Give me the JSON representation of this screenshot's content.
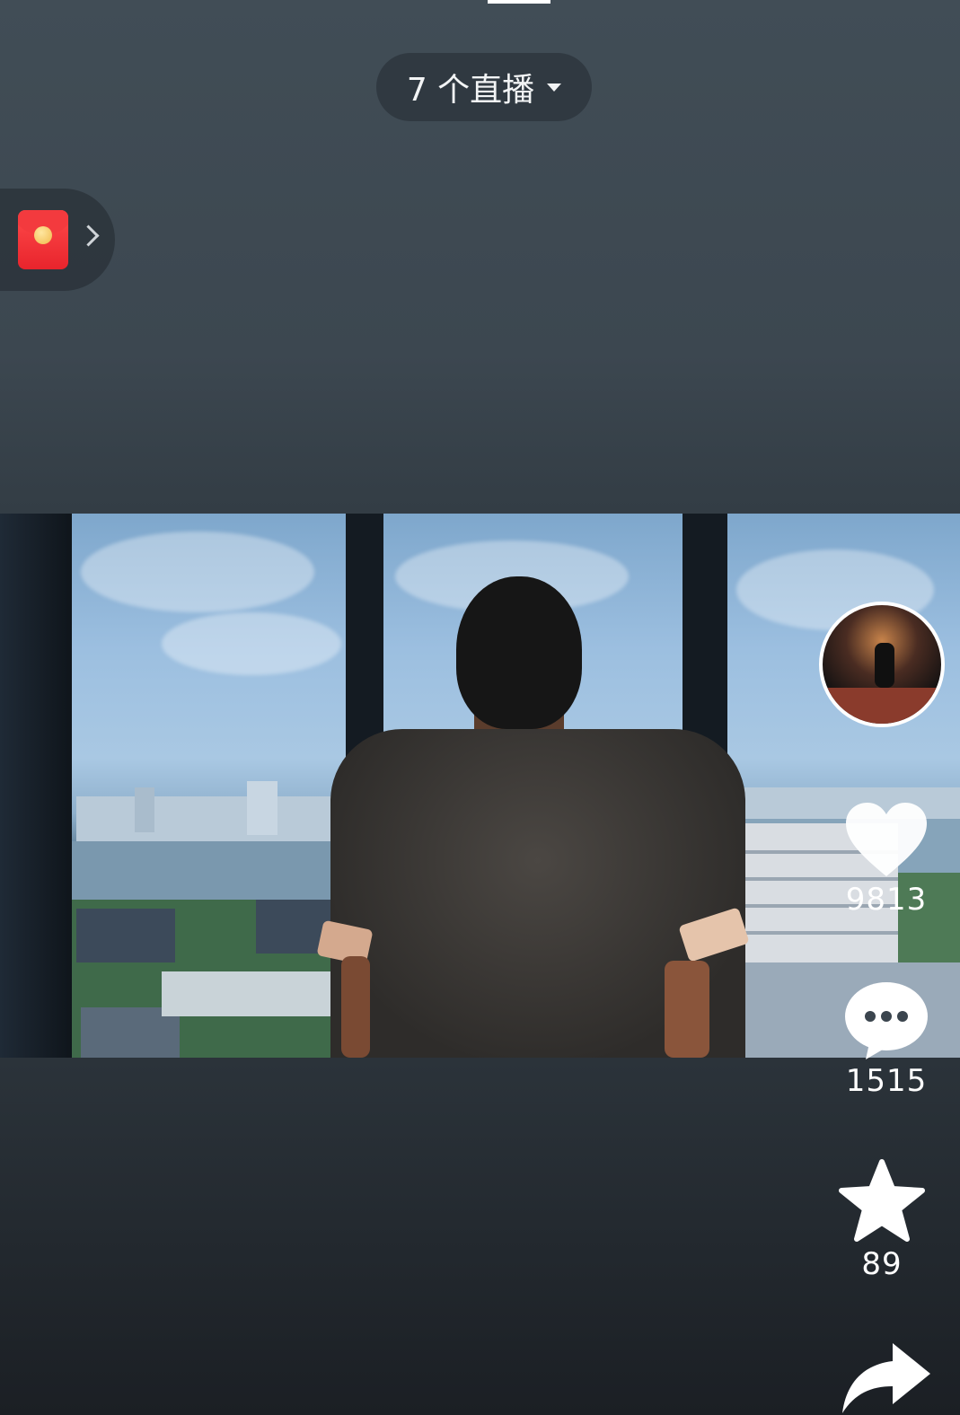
{
  "header": {
    "live_label": "7 个直播"
  },
  "actions": {
    "like_count": "9813",
    "comment_count": "1515",
    "favorite_count": "89"
  },
  "icons": {
    "live_dropdown": "caret-down-icon",
    "red_packet": "red-packet-icon",
    "chevron": "chevron-right-icon",
    "like": "heart-icon",
    "comment": "comment-bubble-icon",
    "favorite": "star-icon",
    "share": "share-arrow-icon"
  },
  "colors": {
    "background_top": "#414d56",
    "background_bottom": "#1b1f24",
    "red_packet": "#e8242c",
    "icon_white": "#ffffff"
  }
}
